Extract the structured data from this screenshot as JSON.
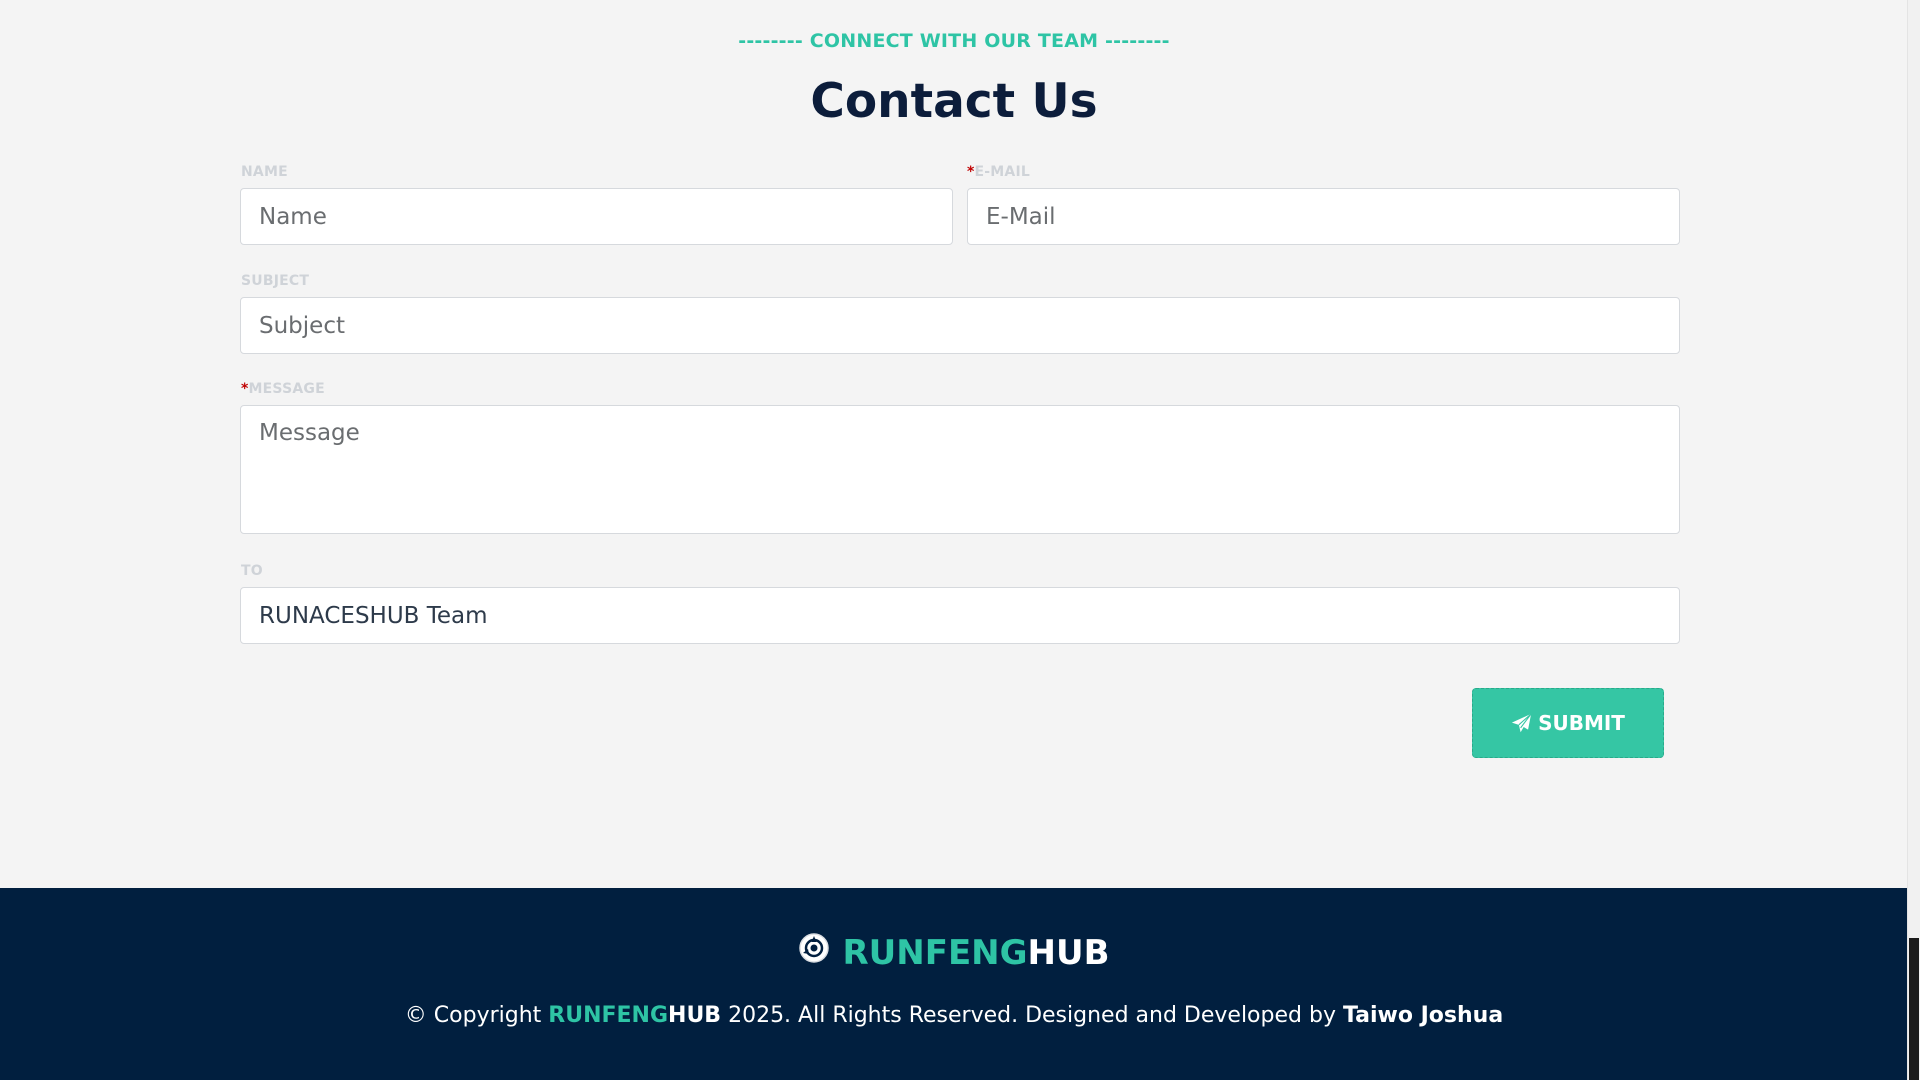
{
  "header": {
    "eyebrow": "-------- CONNECT WITH OUR TEAM --------",
    "title": "Contact Us"
  },
  "form": {
    "name": {
      "label": "NAME",
      "placeholder": "Name",
      "value": ""
    },
    "email": {
      "required_mark": "*",
      "label": "E-MAIL",
      "placeholder": "E-Mail",
      "value": ""
    },
    "subject": {
      "label": "SUBJECT",
      "placeholder": "Subject",
      "value": ""
    },
    "message": {
      "required_mark": "*",
      "label": "MESSAGE",
      "placeholder": "Message",
      "value": ""
    },
    "to": {
      "label": "TO",
      "value": "RUNACESHUB Team"
    },
    "submit_label": "SUBMIT",
    "submit_icon": "paper-plane-icon"
  },
  "footer": {
    "logo_icon": "brand-logo-icon",
    "brand_accent": "RUNFENG",
    "brand_rest": "HUB",
    "copyright_prefix": "© Copyright ",
    "copyright_brand_accent": "RUNFENG",
    "copyright_brand_rest": "HUB",
    "copyright_suffix": " 2025. All Rights Reserved. Designed and Developed by ",
    "developer": "Taiwo Joshua"
  },
  "colors": {
    "accent": "#2ec4a5",
    "title": "#0c1d3b",
    "footer_bg": "#011f3f",
    "required": "#c00000"
  }
}
